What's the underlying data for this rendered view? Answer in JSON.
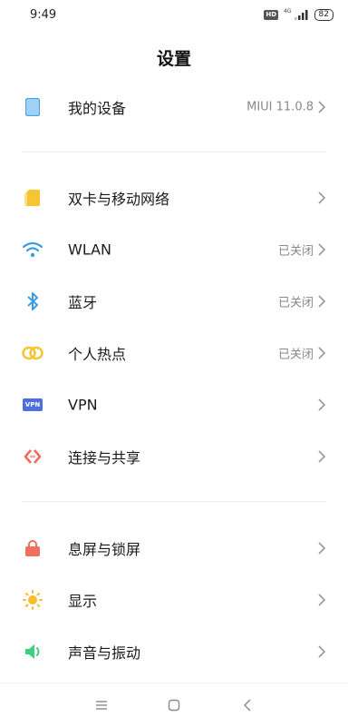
{
  "status_bar": {
    "time": "9:49",
    "hd": "HD",
    "network": "4G",
    "battery": "82"
  },
  "header": {
    "title": "设置"
  },
  "sections": {
    "device": {
      "label": "我的设备",
      "value": "MIUI 11.0.8",
      "icon": "phone-icon",
      "color": "#4aa3e8"
    },
    "dual_sim": {
      "label": "双卡与移动网络",
      "icon": "sim-card-icon",
      "color": "#f7c531"
    },
    "wlan": {
      "label": "WLAN",
      "value": "已关闭",
      "icon": "wifi-icon",
      "color": "#3b9ce6"
    },
    "bluetooth": {
      "label": "蓝牙",
      "value": "已关闭",
      "icon": "bluetooth-icon",
      "color": "#3b9ce6"
    },
    "hotspot": {
      "label": "个人热点",
      "value": "已关闭",
      "icon": "hotspot-icon",
      "color": "#f5c431"
    },
    "vpn": {
      "label": "VPN",
      "badge": "VPN",
      "icon": "vpn-icon",
      "color": "#4f6fe0"
    },
    "share": {
      "label": "连接与共享",
      "icon": "share-icon",
      "color": "#ee6a5a"
    },
    "lock": {
      "label": "息屏与锁屏",
      "icon": "lock-icon",
      "color": "#f07060"
    },
    "display": {
      "label": "显示",
      "icon": "sun-icon",
      "color": "#f5bd2f"
    },
    "sound": {
      "label": "声音与振动",
      "icon": "speaker-icon",
      "color": "#3fcf7f"
    }
  },
  "nav": {
    "menu_icon": "menu-icon",
    "home_icon": "home-icon",
    "back_icon": "back-icon"
  }
}
